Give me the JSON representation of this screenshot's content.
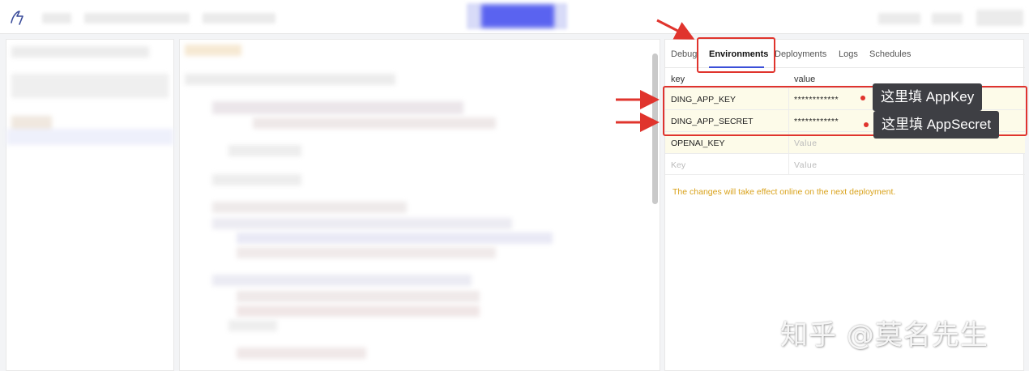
{
  "tabs": [
    {
      "label": "Debug",
      "active": false
    },
    {
      "label": "Environments",
      "active": true
    },
    {
      "label": "Deployments",
      "active": false
    },
    {
      "label": "Logs",
      "active": false
    },
    {
      "label": "Schedules",
      "active": false
    }
  ],
  "env_table": {
    "headers": {
      "key": "key",
      "value": "value"
    },
    "rows": [
      {
        "key": "DING_APP_KEY",
        "value": "************"
      },
      {
        "key": "DING_APP_SECRET",
        "value": "************"
      },
      {
        "key": "OPENAI_KEY",
        "value": "Value"
      }
    ],
    "new_row": {
      "key_placeholder": "Key",
      "value_placeholder": "Value"
    },
    "notice": "The changes will take effect online on the next deployment."
  },
  "annotations": {
    "callout_appkey": "这里填 AppKey",
    "callout_appsecret": "这里填 AppSecret",
    "accent_color": "#e0342d"
  },
  "watermark": "知乎 @莫名先生",
  "colors": {
    "tab_underline": "#3b4fd8",
    "notice": "#d9a21b",
    "highlight_row": "#fdfbe9"
  }
}
